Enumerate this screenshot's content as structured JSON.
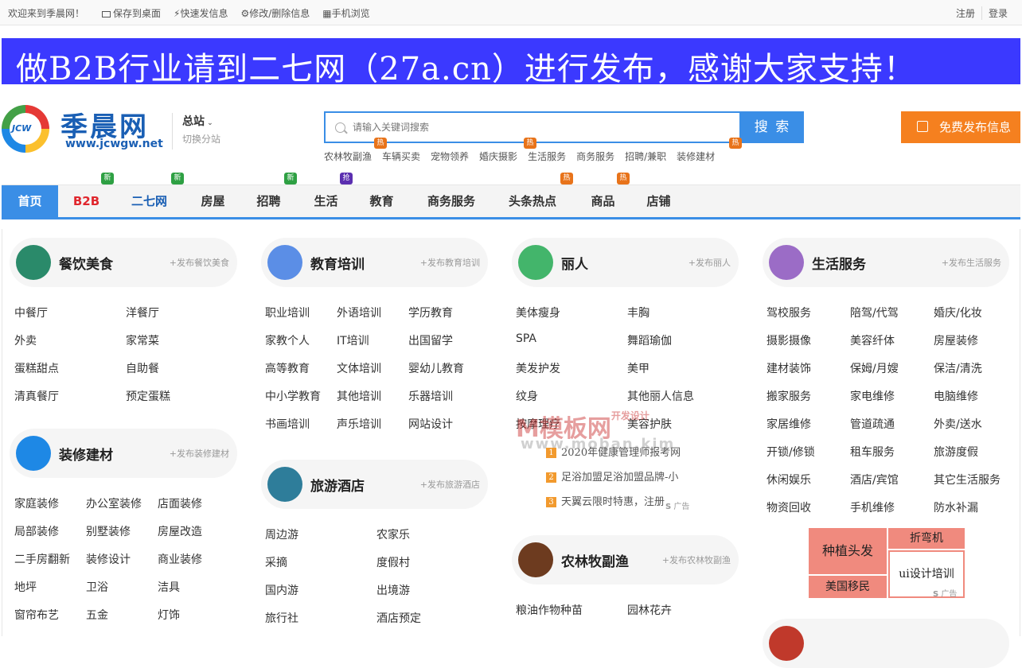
{
  "topbar": {
    "welcome": "欢迎来到季晨网！",
    "links": [
      "保存到桌面",
      "快速发信息",
      "修改/删除信息",
      "手机浏览"
    ],
    "right": [
      "注册",
      "登录"
    ]
  },
  "banner": {
    "text": "做B2B行业请到二七网（27a.cn）进行发布，感谢大家支持！"
  },
  "logo": {
    "name": "季晨网",
    "url": "www.jcwgw.net",
    "mark": "JCW"
  },
  "station": {
    "title": "总站",
    "switch": "切换分站"
  },
  "search": {
    "placeholder": "请输入关键词搜索",
    "button": "搜 索"
  },
  "hotlinks": [
    "农林牧副渔",
    "车辆买卖",
    "宠物领养",
    "婚庆摄影",
    "生活服务",
    "商务服务",
    "招聘/兼职",
    "装修建材"
  ],
  "hot_badge": "热",
  "publish_button": "免费发布信息",
  "nav": {
    "items": [
      "首页",
      "B2B",
      "二七网",
      "房屋",
      "招聘",
      "生活",
      "教育",
      "商务服务",
      "头条热点",
      "商品",
      "店铺"
    ],
    "badges": {
      "new": "新",
      "grab": "抢",
      "hot": "热"
    }
  },
  "categories": {
    "food": {
      "title": "餐饮美食",
      "publish": "+发布餐饮美食",
      "links": [
        "中餐厅",
        "洋餐厅",
        "外卖",
        "家常菜",
        "蛋糕甜点",
        "自助餐",
        "清真餐厅",
        "预定蛋糕"
      ]
    },
    "decor": {
      "title": "装修建材",
      "publish": "+发布装修建材",
      "links": [
        "家庭装修",
        "办公室装修",
        "店面装修",
        "局部装修",
        "别墅装修",
        "房屋改造",
        "二手房翻新",
        "装修设计",
        "商业装修",
        "地坪",
        "卫浴",
        "洁具",
        "窗帘布艺",
        "五金",
        "灯饰"
      ]
    },
    "edu": {
      "title": "教育培训",
      "publish": "+发布教育培训",
      "links": [
        "职业培训",
        "外语培训",
        "学历教育",
        "家教个人",
        "IT培训",
        "出国留学",
        "高等教育",
        "文体培训",
        "婴幼儿教育",
        "中小学教育",
        "其他培训",
        "乐器培训",
        "书画培训",
        "声乐培训",
        "网站设计"
      ]
    },
    "travel": {
      "title": "旅游酒店",
      "publish": "+发布旅游酒店",
      "links": [
        "周边游",
        "农家乐",
        "采摘",
        "度假村",
        "国内游",
        "出境游",
        "旅行社",
        "酒店预定"
      ]
    },
    "beauty": {
      "title": "丽人",
      "publish": "+发布丽人",
      "links": [
        "美体瘦身",
        "丰胸",
        "SPA",
        "舞蹈瑜伽",
        "美发护发",
        "美甲",
        "纹身",
        "其他丽人信息",
        "按摩理疗",
        "美容护肤"
      ]
    },
    "agri": {
      "title": "农林牧副渔",
      "publish": "+发布农林牧副渔",
      "links": [
        "粮油作物种苗",
        "园林花卉"
      ]
    },
    "life": {
      "title": "生活服务",
      "publish": "+发布生活服务",
      "links": [
        "驾校服务",
        "陪驾/代驾",
        "婚庆/化妆",
        "摄影摄像",
        "美容纤体",
        "房屋装修",
        "建材装饰",
        "保姆/月嫂",
        "保洁/清洗",
        "搬家服务",
        "家电维修",
        "电脑维修",
        "家居维修",
        "管道疏通",
        "外卖/送水",
        "开锁/修锁",
        "租车服务",
        "旅游度假",
        "休闲娱乐",
        "酒店/宾馆",
        "其它生活服务",
        "物资回收",
        "手机维修",
        "防水补漏"
      ]
    }
  },
  "ads": {
    "lines": [
      "2020年健康管理师报考网",
      "足浴加盟足浴加盟品牌-小",
      "天翼云限时特惠，注册"
    ],
    "numbers": [
      "1",
      "2",
      "3"
    ],
    "tag": "广告"
  },
  "watermark": {
    "main": "模板网",
    "sub": "www.moban.kim",
    "side": "开发设计"
  },
  "tiles": [
    "种植头发",
    "折弯机",
    "ui设计培训",
    "美国移民"
  ],
  "colors": {
    "accent": "#3a8ee6",
    "banner": "#3b39ff",
    "publish": "#f5801f",
    "hot": "#e8731a",
    "new": "#2ea043"
  }
}
